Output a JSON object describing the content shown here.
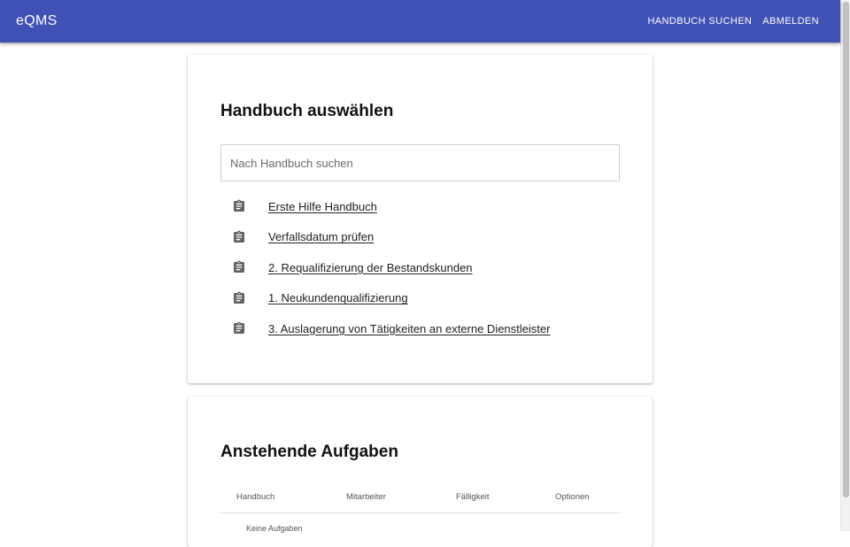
{
  "app": {
    "title": "eQMS"
  },
  "header": {
    "nav": [
      {
        "label": "HANDBUCH SUCHEN",
        "icon": ""
      },
      {
        "label": "ABMELDEN",
        "icon": ""
      }
    ],
    "colors": {
      "primary": "#3f51b5",
      "on_primary": "#ffffff"
    }
  },
  "manual_card": {
    "title": "Handbuch auswählen",
    "search": {
      "placeholder": "Nach Handbuch suchen",
      "value": ""
    },
    "items": [
      {
        "label": "Erste Hilfe Handbuch",
        "icon": "clipboard-icon"
      },
      {
        "label": "Verfallsdatum prüfen",
        "icon": "clipboard-icon"
      },
      {
        "label": "2. Requalifizierung der Bestandskunden",
        "icon": "clipboard-icon"
      },
      {
        "label": "1. Neukundenqualifizierung",
        "icon": "clipboard-icon"
      },
      {
        "label": "3. Auslagerung von Tätigkeiten an externe Dienstleister",
        "icon": "clipboard-icon"
      }
    ]
  },
  "tasks_card": {
    "title": "Anstehende Aufgaben",
    "columns": [
      "Handbuch",
      "Mitarbeiter",
      "Fälligkeit",
      "Optionen"
    ],
    "empty_text": "Keine Aufgaben"
  }
}
